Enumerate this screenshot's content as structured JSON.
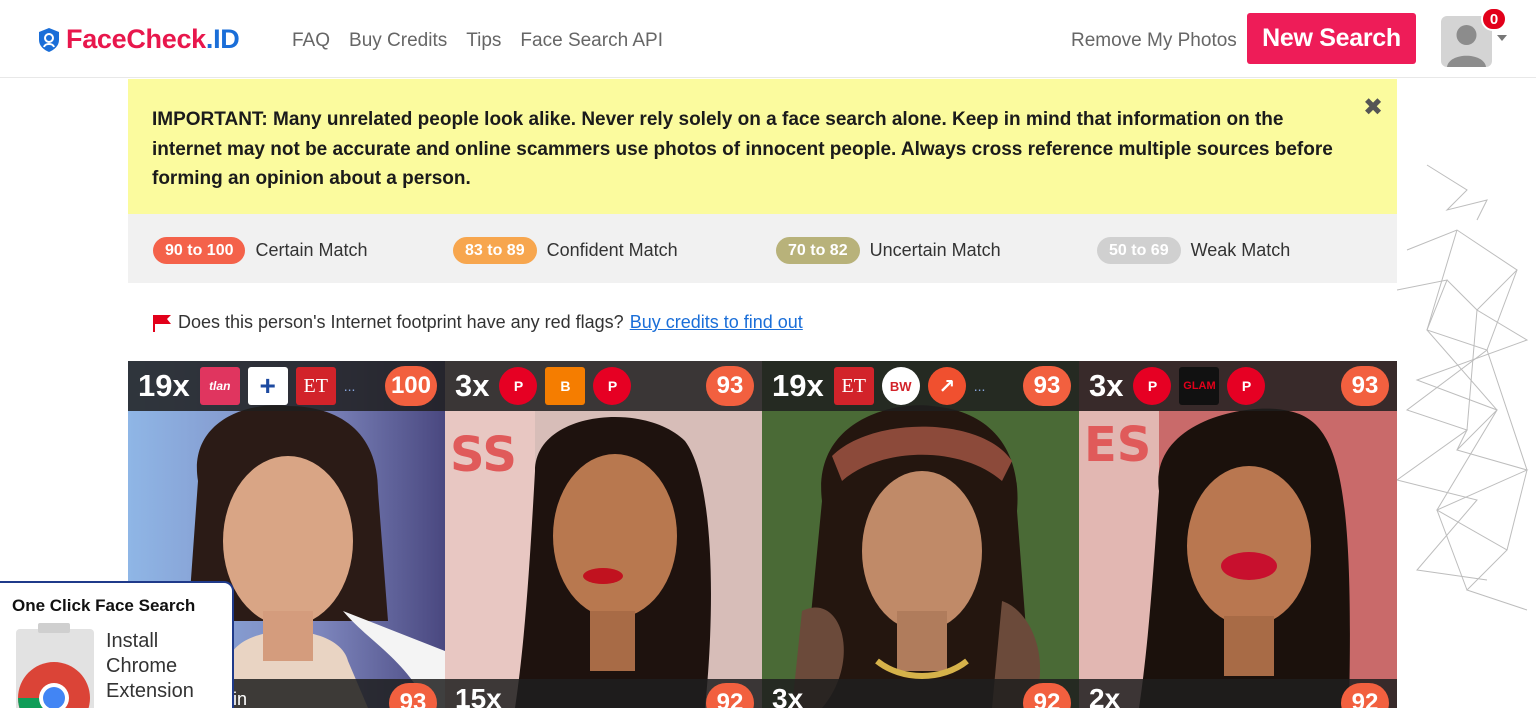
{
  "brand": {
    "face": "FaceCheck",
    "id": ".ID"
  },
  "nav": {
    "items": [
      "FAQ",
      "Buy Credits",
      "Tips",
      "Face Search API"
    ],
    "remove": "Remove My Photos",
    "new_search": "New Search",
    "badge": "0"
  },
  "warning": {
    "text": "IMPORTANT: Many unrelated people look alike. Never rely solely on a face search alone. Keep in mind that information on the internet may not be accurate and online scammers use photos of innocent people. Always cross reference multiple sources before forming an opinion about a person."
  },
  "legend": [
    {
      "range": "90 to 100",
      "label": "Certain Match",
      "color": "#f4624a"
    },
    {
      "range": "83 to 89",
      "label": "Confident Match",
      "color": "#f7a64e"
    },
    {
      "range": "70 to 82",
      "label": "Uncertain Match",
      "color": "#b8b27a"
    },
    {
      "range": "50 to 69",
      "label": "Weak Match",
      "color": "#d0d0d0"
    }
  ],
  "redflag": {
    "question": "Does this person's Internet footprint have any red flags?",
    "link": "Buy credits to find out"
  },
  "results": [
    {
      "count": "19x",
      "score": "100",
      "sources": [
        {
          "icon": "tellychakkar-icon",
          "text": "tlan",
          "color": "#e0355f"
        },
        {
          "icon": "plus-icon",
          "text": "+",
          "color": "#ffffff"
        },
        {
          "icon": "et-icon",
          "text": "ET",
          "color": "#d2232a"
        }
      ],
      "more": "...",
      "photo_bg": "#7c8fc4"
    },
    {
      "count": "3x",
      "score": "93",
      "sources": [
        {
          "icon": "pinterest-icon",
          "text": "P",
          "color": "#e60023"
        },
        {
          "icon": "blogger-icon",
          "text": "B",
          "color": "#f57d00"
        },
        {
          "icon": "pinterest-icon",
          "text": "P",
          "color": "#e60023"
        }
      ],
      "more": "",
      "photo_bg": "#c9a8a8"
    },
    {
      "count": "19x",
      "score": "93",
      "sources": [
        {
          "icon": "et-icon",
          "text": "ET",
          "color": "#d2232a"
        },
        {
          "icon": "bw-icon",
          "text": "BW",
          "color": "#ffffff"
        },
        {
          "icon": "trending-icon",
          "text": "↗",
          "color": "#f0502f"
        }
      ],
      "more": "...",
      "photo_bg": "#3c5a2c"
    },
    {
      "count": "3x",
      "score": "93",
      "sources": [
        {
          "icon": "pinterest-icon",
          "text": "P",
          "color": "#e60023"
        },
        {
          "icon": "glamcheck-icon",
          "text": "GLAM",
          "color": "#111111"
        },
        {
          "icon": "pinterest-icon",
          "text": "P",
          "color": "#e60023"
        }
      ],
      "more": "",
      "photo_bg": "#c45b5b"
    }
  ],
  "results_row2": [
    {
      "count": "",
      "label": ".in",
      "score": "93"
    },
    {
      "count": "15x",
      "score": "92"
    },
    {
      "count": "3x",
      "score": "92"
    },
    {
      "count": "2x",
      "score": "92"
    }
  ],
  "extension": {
    "title": "One Click Face Search",
    "lines": [
      "Install",
      "Chrome",
      "Extension"
    ]
  },
  "colors": {
    "accent": "#ee1c58",
    "link": "#1a6ed8",
    "score": "#f2603f"
  }
}
